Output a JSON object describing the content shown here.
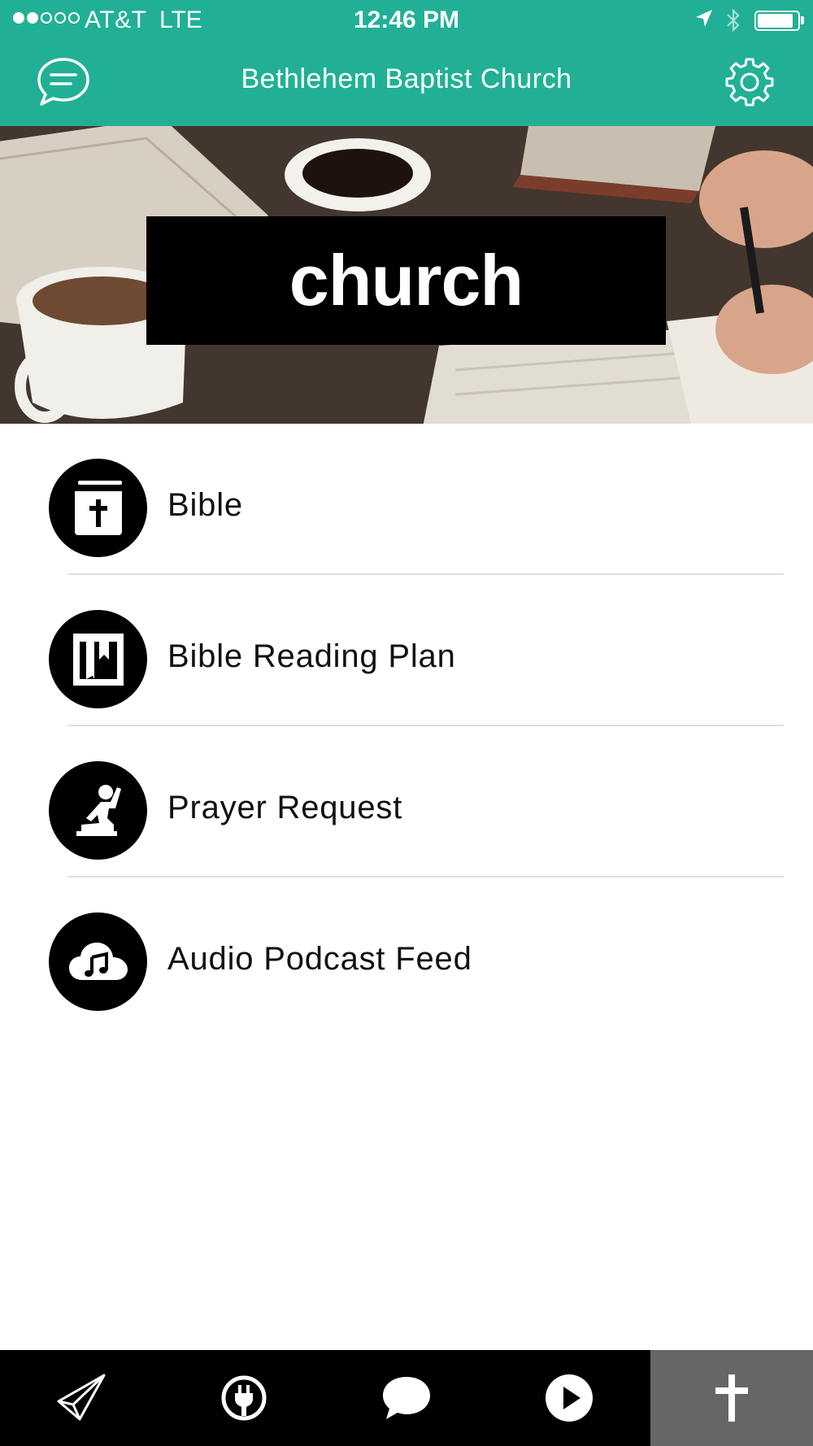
{
  "status_bar": {
    "carrier": "AT&T",
    "network": "LTE",
    "time": "12:46 PM",
    "signal_bars_filled": 2,
    "signal_bars_total": 5,
    "battery_level": 0.9,
    "icons": [
      "location-arrow-icon",
      "bluetooth-icon",
      "battery-icon"
    ]
  },
  "header": {
    "title": "Bethlehem Baptist Church",
    "left_icon": "chat-bubble-icon",
    "right_icon": "gear-icon"
  },
  "hero": {
    "banner_text": "church"
  },
  "menu": {
    "items": [
      {
        "label": "Bible",
        "icon": "bible-icon"
      },
      {
        "label": "Bible Reading Plan",
        "icon": "reading-plan-book-icon"
      },
      {
        "label": "Prayer Request",
        "icon": "praying-person-icon"
      },
      {
        "label": "Audio Podcast Feed",
        "icon": "cloud-music-icon"
      }
    ]
  },
  "tab_bar": {
    "tabs": [
      {
        "icon": "paper-plane-icon",
        "active": false
      },
      {
        "icon": "plug-icon",
        "active": false
      },
      {
        "icon": "speech-bubble-icon",
        "active": false
      },
      {
        "icon": "play-icon",
        "active": false
      },
      {
        "icon": "cross-icon",
        "active": true
      }
    ]
  },
  "colors": {
    "brand": "#21b096",
    "tab_bar_bg": "#000000",
    "tab_active_bg": "#666666",
    "icon_circle": "#000000"
  }
}
